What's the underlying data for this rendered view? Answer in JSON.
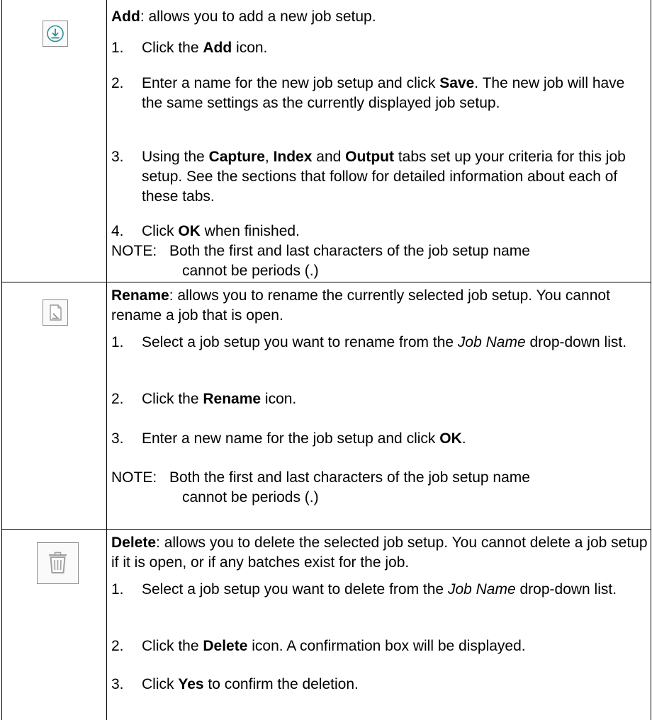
{
  "rows": [
    {
      "icon": "add-download-icon",
      "title": "Add",
      "lead_rest": ": allows you to add a new job setup.",
      "steps": [
        {
          "num": "1.",
          "a": "Click the ",
          "b": "Add",
          "c": " icon."
        },
        {
          "num": "2.",
          "a": "Enter a name for the new job setup and click ",
          "b": "Save",
          "c": ". The new job will have the same settings as the currently displayed job setup."
        },
        {
          "num": "3.",
          "a": "Using the ",
          "b": "Capture",
          "c": ", ",
          "d": "Index",
          "e": " and ",
          "f": "Output",
          "g": " tabs set up your criteria for this job setup. See the sections that follow for detailed information about each of these tabs."
        },
        {
          "num": "4.",
          "a": "Click ",
          "b": "OK",
          "c": " when finished."
        }
      ],
      "note_label": "NOTE:",
      "note_line1": "Both the first and last characters of the job setup name",
      "note_line2": "cannot be periods (.)"
    },
    {
      "icon": "rename-document-icon",
      "title": "Rename",
      "lead_rest": ": allows you to rename the currently selected job setup. You cannot rename a job that is open.",
      "steps": [
        {
          "num": "1.",
          "a": "Select a job setup you want to rename from the ",
          "i": "Job Name",
          "c": " drop-down list."
        },
        {
          "num": "2.",
          "a": "Click the ",
          "b": "Rename",
          "c": " icon."
        },
        {
          "num": "3.",
          "a": "Enter a new name for the job setup and click ",
          "b": "OK",
          "c": "."
        }
      ],
      "note_label": "NOTE:",
      "note_line1": "Both the first and last characters of the job setup name",
      "note_line2": "cannot be periods (.)"
    },
    {
      "icon": "trash-can-icon",
      "title": "Delete",
      "lead_rest": ": allows you to delete the selected job setup. You cannot delete a job setup if it is open, or if any batches exist for the job.",
      "steps": [
        {
          "num": "1.",
          "a": "Select a job setup you want to delete from the ",
          "i": "Job Name",
          "c": " drop-down list."
        },
        {
          "num": "2.",
          "a": "Click the ",
          "b": "Delete",
          "c": " icon. A confirmation box will be displayed."
        },
        {
          "num": "3.",
          "a": "Click ",
          "b": "Yes",
          "c": " to confirm the deletion."
        }
      ]
    }
  ],
  "colors": {
    "icon_teal": "#2e8f9a",
    "icon_gray": "#9a9a9a",
    "border": "#000000"
  }
}
